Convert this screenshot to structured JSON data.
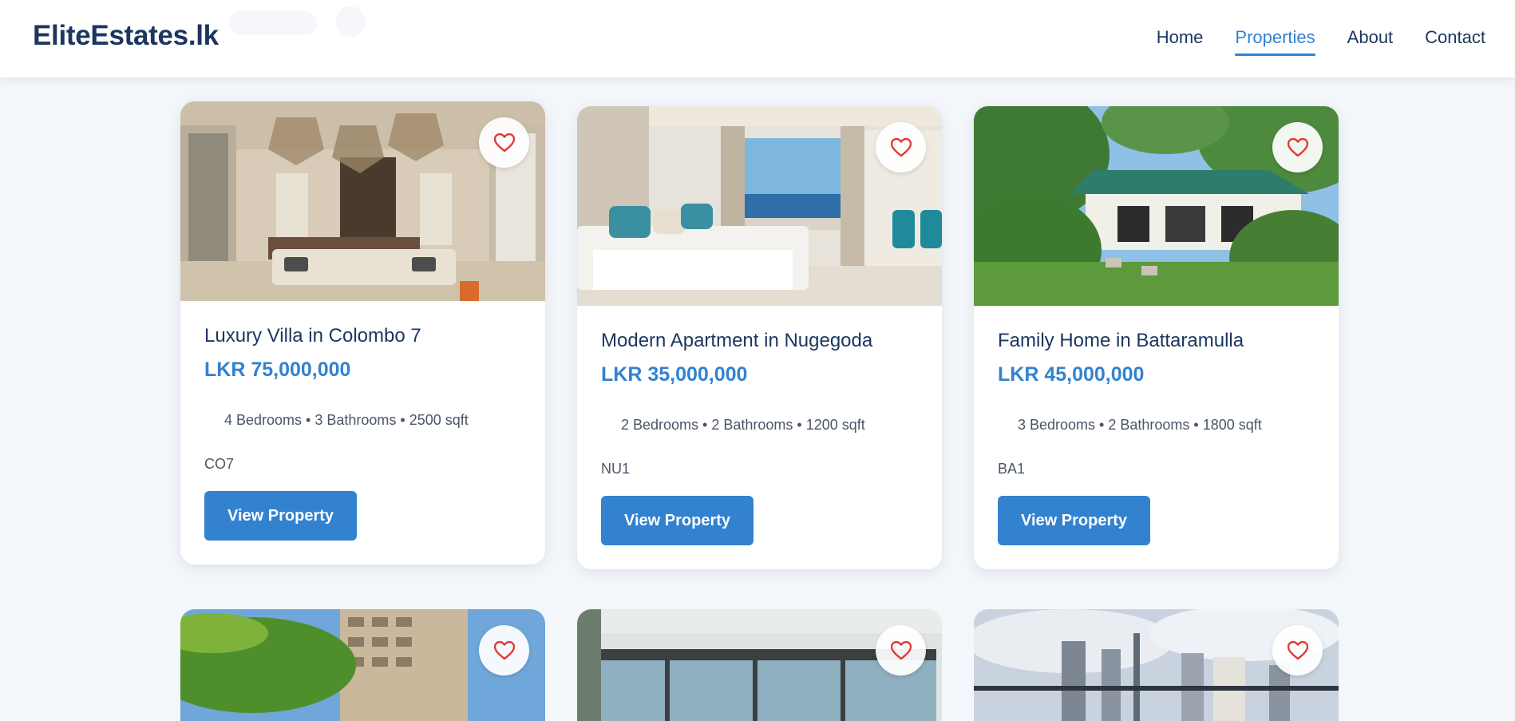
{
  "brand": {
    "logo": "EliteEstates.lk"
  },
  "nav": {
    "items": [
      {
        "label": "Home",
        "active": false
      },
      {
        "label": "Properties",
        "active": true
      },
      {
        "label": "About",
        "active": false
      },
      {
        "label": "Contact",
        "active": false
      }
    ]
  },
  "colors": {
    "accent": "#3282d0",
    "brand": "#1b365f",
    "heart": "#e53935"
  },
  "listings": [
    {
      "title": "Luxury Villa in Colombo 7",
      "price": "LKR 75,000,000",
      "specs": "4 Bedrooms • 3 Bathrooms • 2500 sqft",
      "code": "CO7",
      "button": "View Property",
      "favorite_icon": "heart-outline-icon"
    },
    {
      "title": "Modern Apartment in Nugegoda",
      "price": "LKR 35,000,000",
      "specs": "2 Bedrooms • 2 Bathrooms • 1200 sqft",
      "code": "NU1",
      "button": "View Property",
      "favorite_icon": "heart-outline-icon"
    },
    {
      "title": "Family Home in Battaramulla",
      "price": "LKR 45,000,000",
      "specs": "3 Bedrooms • 2 Bathrooms • 1800 sqft",
      "code": "BA1",
      "button": "View Property",
      "favorite_icon": "heart-outline-icon"
    }
  ]
}
